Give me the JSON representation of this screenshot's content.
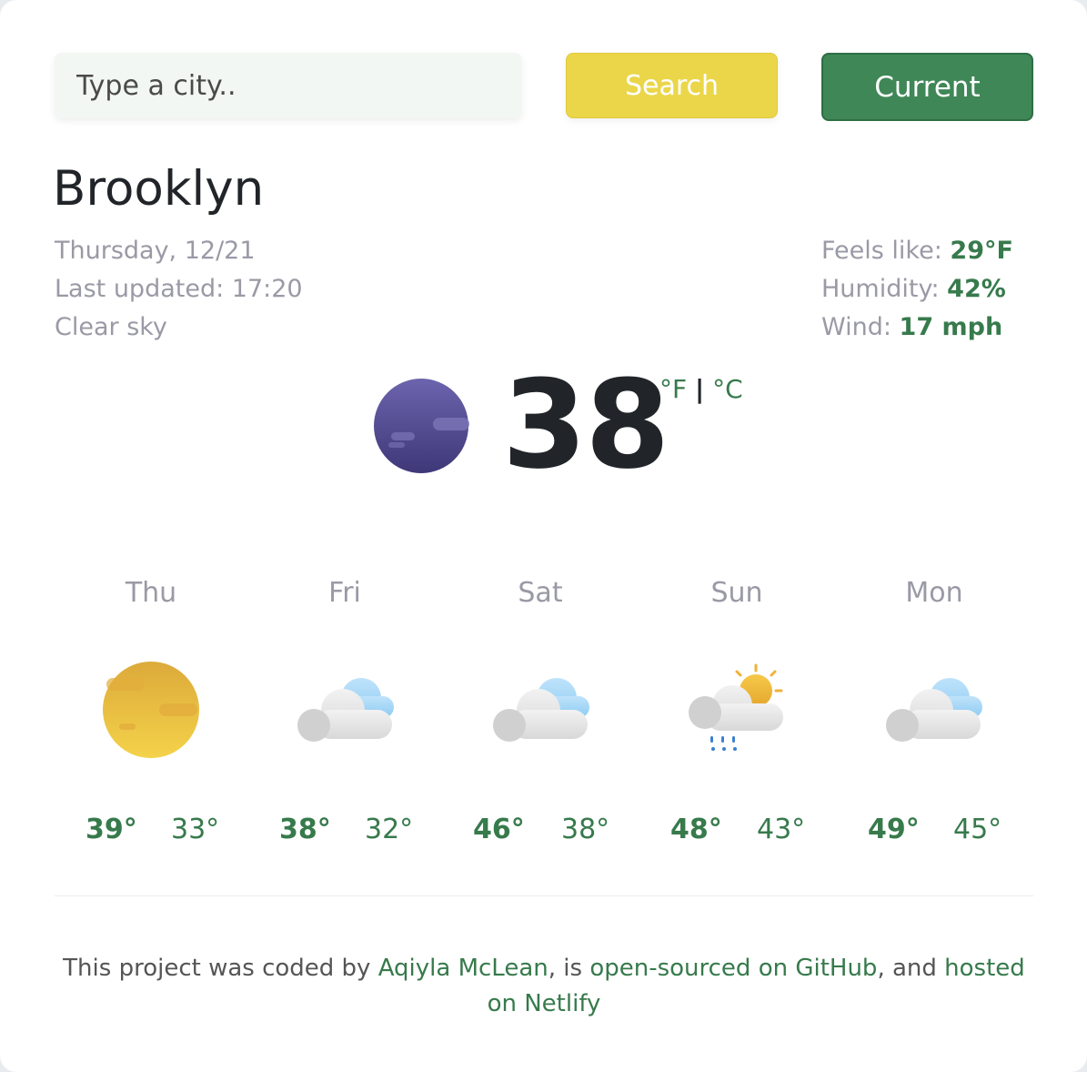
{
  "search": {
    "placeholder": "Type a city..",
    "search_label": "Search",
    "current_label": "Current"
  },
  "city": "Brooklyn",
  "meta": {
    "date": "Thursday, 12/21",
    "last_updated": "Last updated: 17:20",
    "condition": "Clear sky"
  },
  "details": {
    "feels_like_label": "Feels like:",
    "feels_like_value": "29°F",
    "humidity_label": "Humidity:",
    "humidity_value": "42%",
    "wind_label": "Wind:",
    "wind_value": "17 mph"
  },
  "current": {
    "icon": "clear-night-icon",
    "temperature": "38",
    "unit_f": "°F",
    "unit_sep": "|",
    "unit_c": "°C"
  },
  "forecast": [
    {
      "day": "Thu",
      "icon": "sun-icon",
      "max": "39°",
      "min": "33°"
    },
    {
      "day": "Fri",
      "icon": "cloudy-icon",
      "max": "38°",
      "min": "32°"
    },
    {
      "day": "Sat",
      "icon": "cloudy-icon",
      "max": "46°",
      "min": "38°"
    },
    {
      "day": "Sun",
      "icon": "rain-sun-cloud-icon",
      "max": "48°",
      "min": "43°"
    },
    {
      "day": "Mon",
      "icon": "cloudy-icon",
      "max": "49°",
      "min": "45°"
    }
  ],
  "footer": {
    "text1": "This project was coded by ",
    "author": "Aqiyla McLean",
    "text2": ", is ",
    "github": "open-sourced on GitHub",
    "text3": ", and ",
    "netlify": "hosted on Netlify"
  },
  "colors": {
    "accent_green": "#377a4c",
    "current_button": "#3f8757",
    "search_button": "#ebd64a"
  }
}
